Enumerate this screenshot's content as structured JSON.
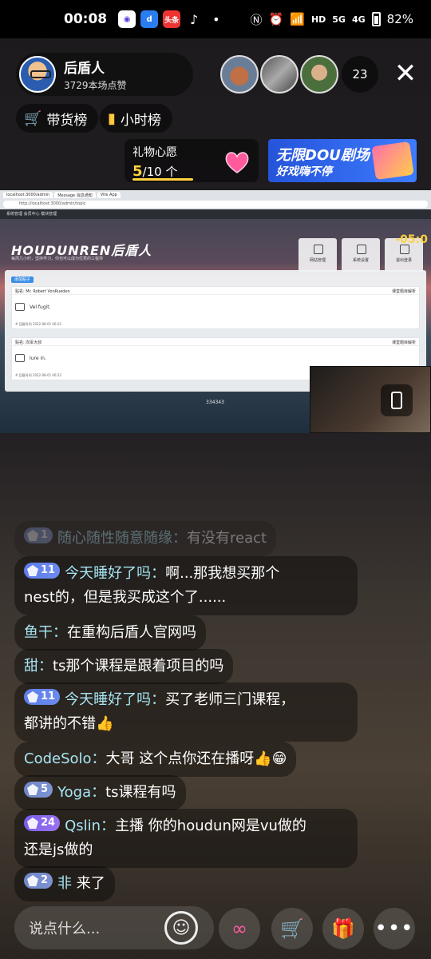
{
  "status_bar": {
    "time": "00:08",
    "battery": "82%",
    "net_5g": "5G",
    "net_4g": "4G",
    "hd": "HD",
    "app_toutiao": "头条"
  },
  "host": {
    "name": "后盾人",
    "likes": "3729本场点赞"
  },
  "viewers": {
    "count": "23"
  },
  "chips": {
    "cart": "带货榜",
    "hourly": "小时榜"
  },
  "gift_wish": {
    "title": "礼物心愿",
    "current": "5",
    "total": "/10 个"
  },
  "promo": {
    "line1": "无限DOU剧场",
    "line2": "好戏嗨不停"
  },
  "stream": {
    "site_logo": "HOUDUNREN后盾人",
    "site_sub": "每周几小时，坚持学习，你也可以成为优秀的工程师",
    "tabs": [
      "localhost:3000/admin",
      "Message 消息通知",
      "Vite App"
    ],
    "address": "http://localhost:3000/admin/topic",
    "bookmarks": "系统管理   会员中心   模块管理",
    "buttons": [
      "网站管理",
      "系统设置",
      "退出登录"
    ],
    "add_button": "添加贴子",
    "timer": "-05:0",
    "posts": [
      {
        "title": "贴名: Mr. Robert VonRueden",
        "tag": "课堂题目解析",
        "body": "Vel fugit.",
        "date": "# 回复时间  2022-08-01 06:22"
      },
      {
        "title": "贴名: 向军大叔",
        "tag": "课堂题目解析",
        "body": "Iure in.",
        "date": "# 回复时间  2022-08-01 06:22"
      }
    ],
    "footer_num": "334343"
  },
  "chat": [
    {
      "badge": "1",
      "name": "随心随性随意随缘：",
      "text": "有没有react",
      "faded": true
    },
    {
      "badge": "11",
      "name": "今天睡好了吗：",
      "text": "啊...那我想买那个",
      "text2": "nest的，但是我买成这个了......"
    },
    {
      "name": "鱼干：",
      "text": "在重构后盾人官网吗"
    },
    {
      "name": "甜：",
      "text": "ts那个课程是跟着项目的吗"
    },
    {
      "badge": "11",
      "name": "今天睡好了吗：",
      "text": "买了老师三门课程，",
      "text2": "都讲的不错👍"
    },
    {
      "name": "CodeSolo：",
      "text": "大哥 这个点你还在播呀👍😁"
    },
    {
      "badge": "5",
      "name": "Yoga：",
      "text": "ts课程有吗"
    },
    {
      "badge": "24",
      "name": "Qslin：",
      "text": "主播 你的houdun网是vu做的",
      "text2": "还是js做的"
    },
    {
      "badge": "2",
      "name": "非",
      "text": " 来了"
    }
  ],
  "bottom": {
    "input_placeholder": "说点什么..."
  },
  "icons": {
    "emoji": "smile-icon",
    "link": "link-icon",
    "cart": "cart-icon",
    "gift": "gift-icon",
    "more": "more-icon"
  }
}
